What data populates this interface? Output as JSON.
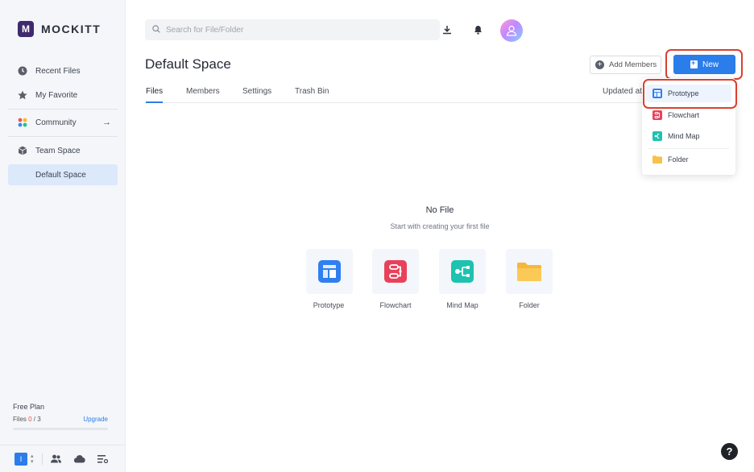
{
  "brand": {
    "name": "MOCKITT",
    "mark": "M"
  },
  "sidebar": {
    "items": [
      {
        "label": "Recent Files",
        "icon": "clock-icon"
      },
      {
        "label": "My Favorite",
        "icon": "star-icon"
      },
      {
        "label": "Community",
        "icon": "community-icon",
        "arrow": "→"
      },
      {
        "label": "Team Space",
        "icon": "cube-icon"
      },
      {
        "label": "Default Space",
        "icon": ""
      }
    ],
    "plan": {
      "name": "Free Plan",
      "files_label": "Files",
      "used": "0",
      "total": " / 3",
      "upgrade": "Upgrade",
      "usage_fraction": 0
    },
    "footer": {
      "avatar_letter": "I"
    }
  },
  "header": {
    "search_placeholder": "Search for File/Folder"
  },
  "main": {
    "title": "Default Space",
    "add_members": "Add Members",
    "new_button": "New",
    "tabs": [
      "Files",
      "Members",
      "Settings",
      "Trash Bin"
    ],
    "updated_label": "Updated at",
    "empty": {
      "title": "No File",
      "subtitle": "Start with creating your first file",
      "tiles": [
        "Prototype",
        "Flowchart",
        "Mind Map",
        "Folder"
      ]
    }
  },
  "dropdown": {
    "items": [
      "Prototype",
      "Flowchart",
      "Mind Map",
      "Folder"
    ]
  },
  "help": {
    "label": "?"
  },
  "colors": {
    "accent": "#2b7de9",
    "highlight": "#d9412f",
    "prototype": "#2f7ff0",
    "flowchart": "#e8425a",
    "mindmap": "#1ec2b0",
    "folder": "#f7c14a"
  }
}
